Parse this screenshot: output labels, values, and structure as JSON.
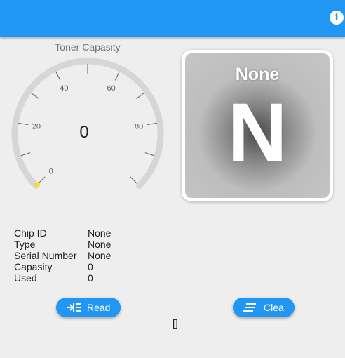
{
  "app_bar": {
    "color": "#2196f3",
    "info_icon": "info-icon"
  },
  "gauge": {
    "title": "Toner Capasity",
    "value": 0,
    "value_text": "0",
    "min": 0,
    "max": 100,
    "tick_labels": [
      "0",
      "20",
      "40",
      "60",
      "80"
    ],
    "track_color": "#d6d6d6",
    "needle_color": "#fdd835"
  },
  "card": {
    "title": "None",
    "letter": "N"
  },
  "info": {
    "rows": [
      {
        "label": "Chip ID",
        "value": "None"
      },
      {
        "label": "Type",
        "value": "None"
      },
      {
        "label": "Serial Number",
        "value": "None"
      },
      {
        "label": "Capasity",
        "value": "0"
      },
      {
        "label": "Used",
        "value": "0"
      }
    ]
  },
  "buttons": {
    "read_label": "Read",
    "read_icon": "input-arrow-icon",
    "clear_label": "Clea",
    "clear_icon": "clear-all-icon"
  },
  "tofu_text": "[]"
}
